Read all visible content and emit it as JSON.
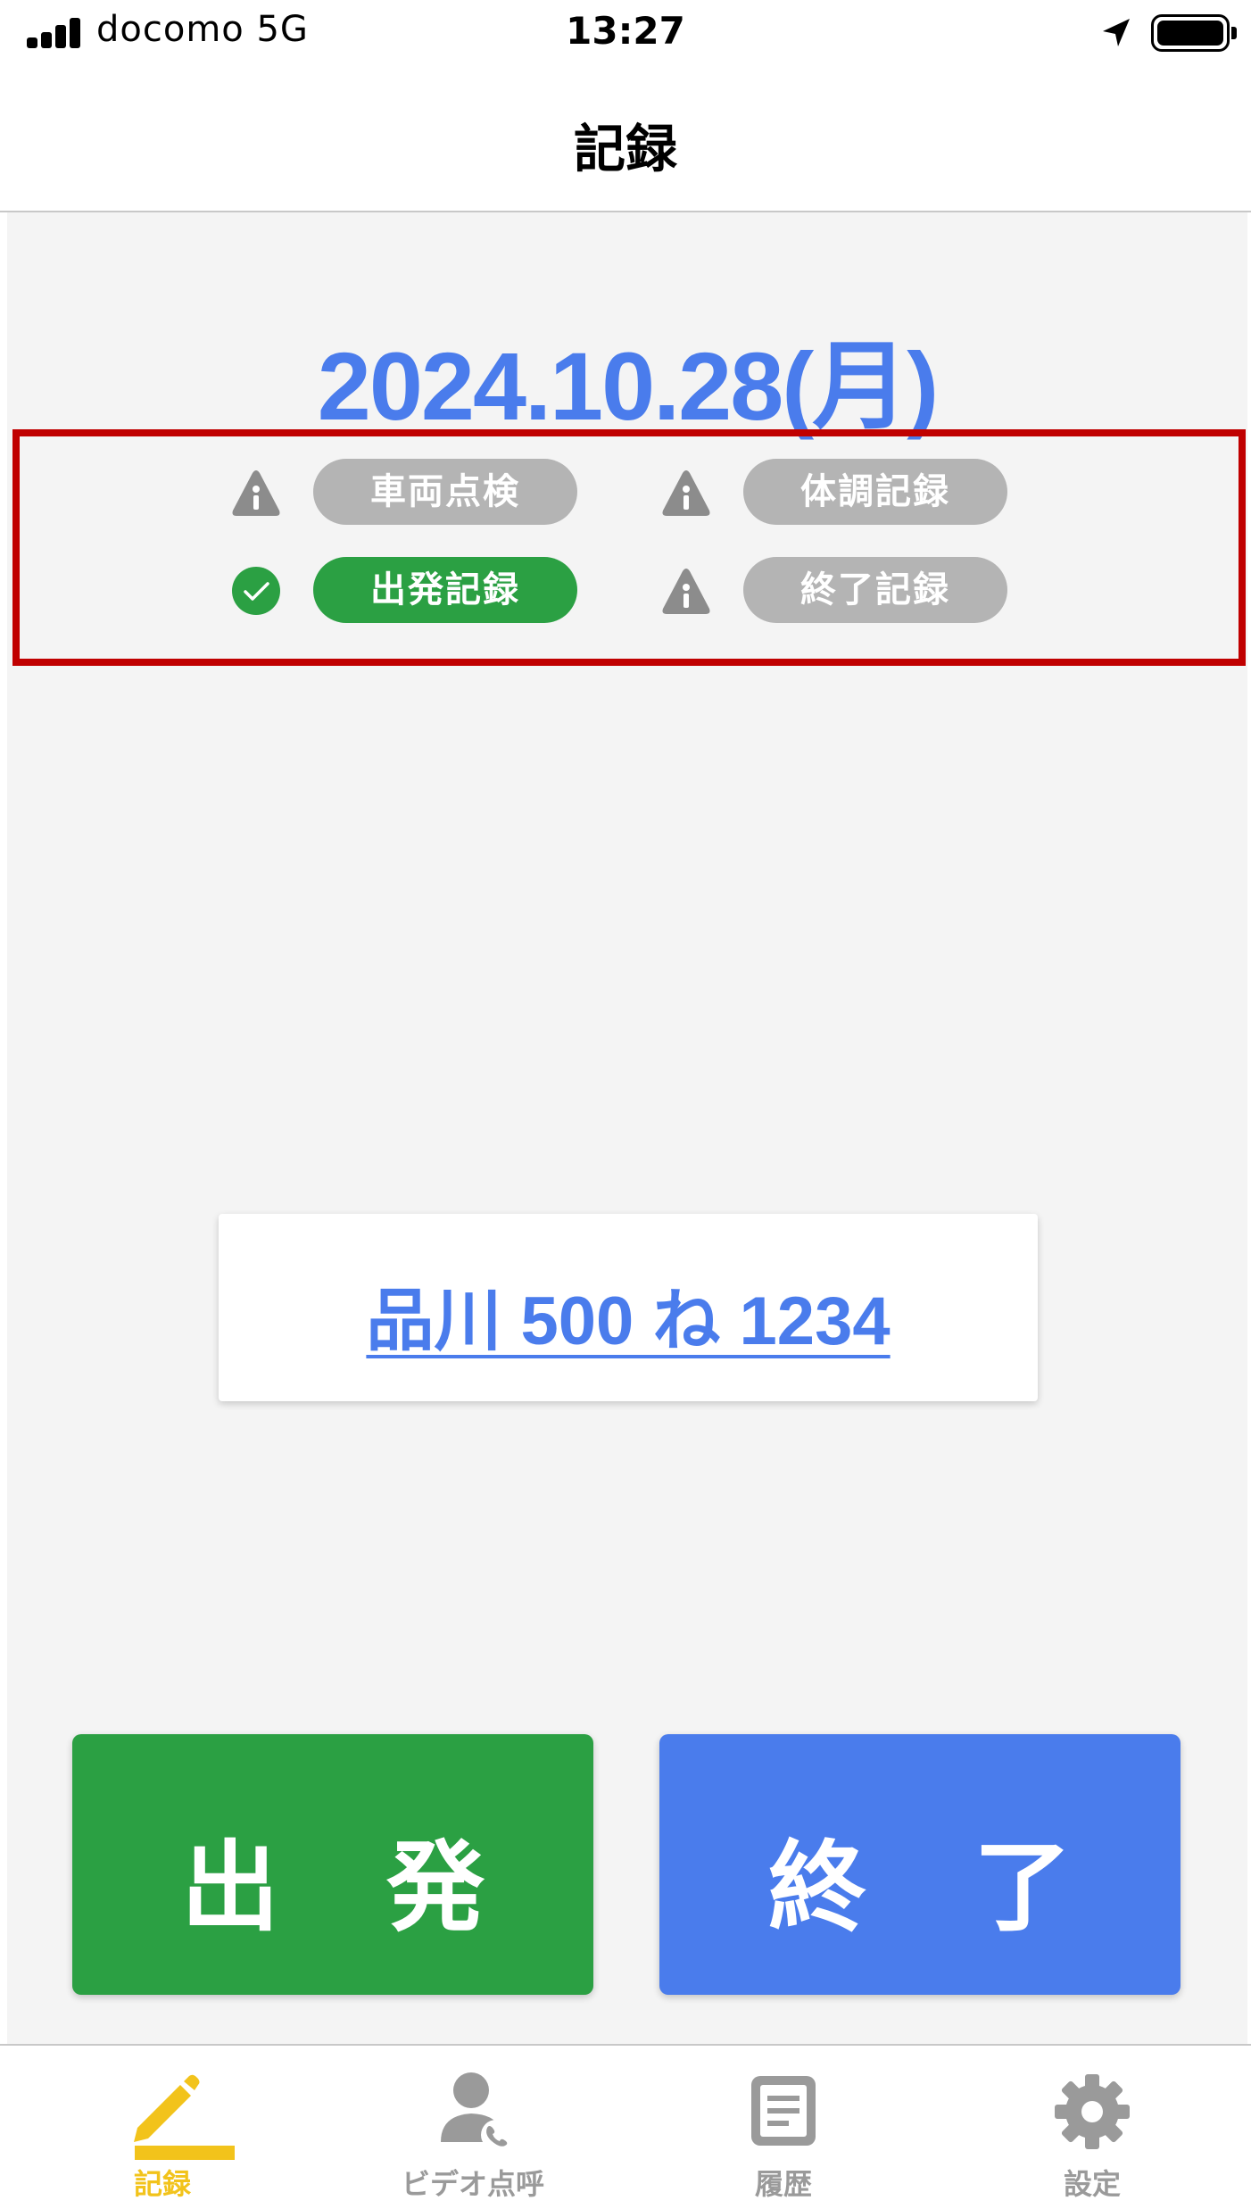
{
  "status_bar": {
    "carrier": "docomo   5G",
    "time": "13:27"
  },
  "nav": {
    "title": "記録"
  },
  "date": "2024.10.28(月)",
  "statuses": [
    {
      "label": "車両点検",
      "state": "warning",
      "icon": "warning-icon"
    },
    {
      "label": "体調記録",
      "state": "warning",
      "icon": "warning-icon"
    },
    {
      "label": "出発記録",
      "state": "done",
      "icon": "check-circle-icon"
    },
    {
      "label": "終了記録",
      "state": "warning",
      "icon": "warning-icon"
    }
  ],
  "vehicle": {
    "plate": "品川 500 ね 1234"
  },
  "buttons": {
    "depart": [
      "出",
      "発"
    ],
    "end": [
      "終",
      "了"
    ]
  },
  "tabs": [
    {
      "label": "記録",
      "icon": "pencil-icon",
      "active": true
    },
    {
      "label": "ビデオ点呼",
      "icon": "video-person-icon",
      "active": false
    },
    {
      "label": "履歴",
      "icon": "document-icon",
      "active": false
    },
    {
      "label": "設定",
      "icon": "gear-icon",
      "active": false
    }
  ],
  "colors": {
    "accent_blue": "#4a7cec",
    "success_green": "#2ba043",
    "pending_gray": "#b4b4b4",
    "highlight_red": "#c00000",
    "active_tab_yellow": "#f2c31b",
    "inactive_tab_gray": "#9a9a9a"
  }
}
